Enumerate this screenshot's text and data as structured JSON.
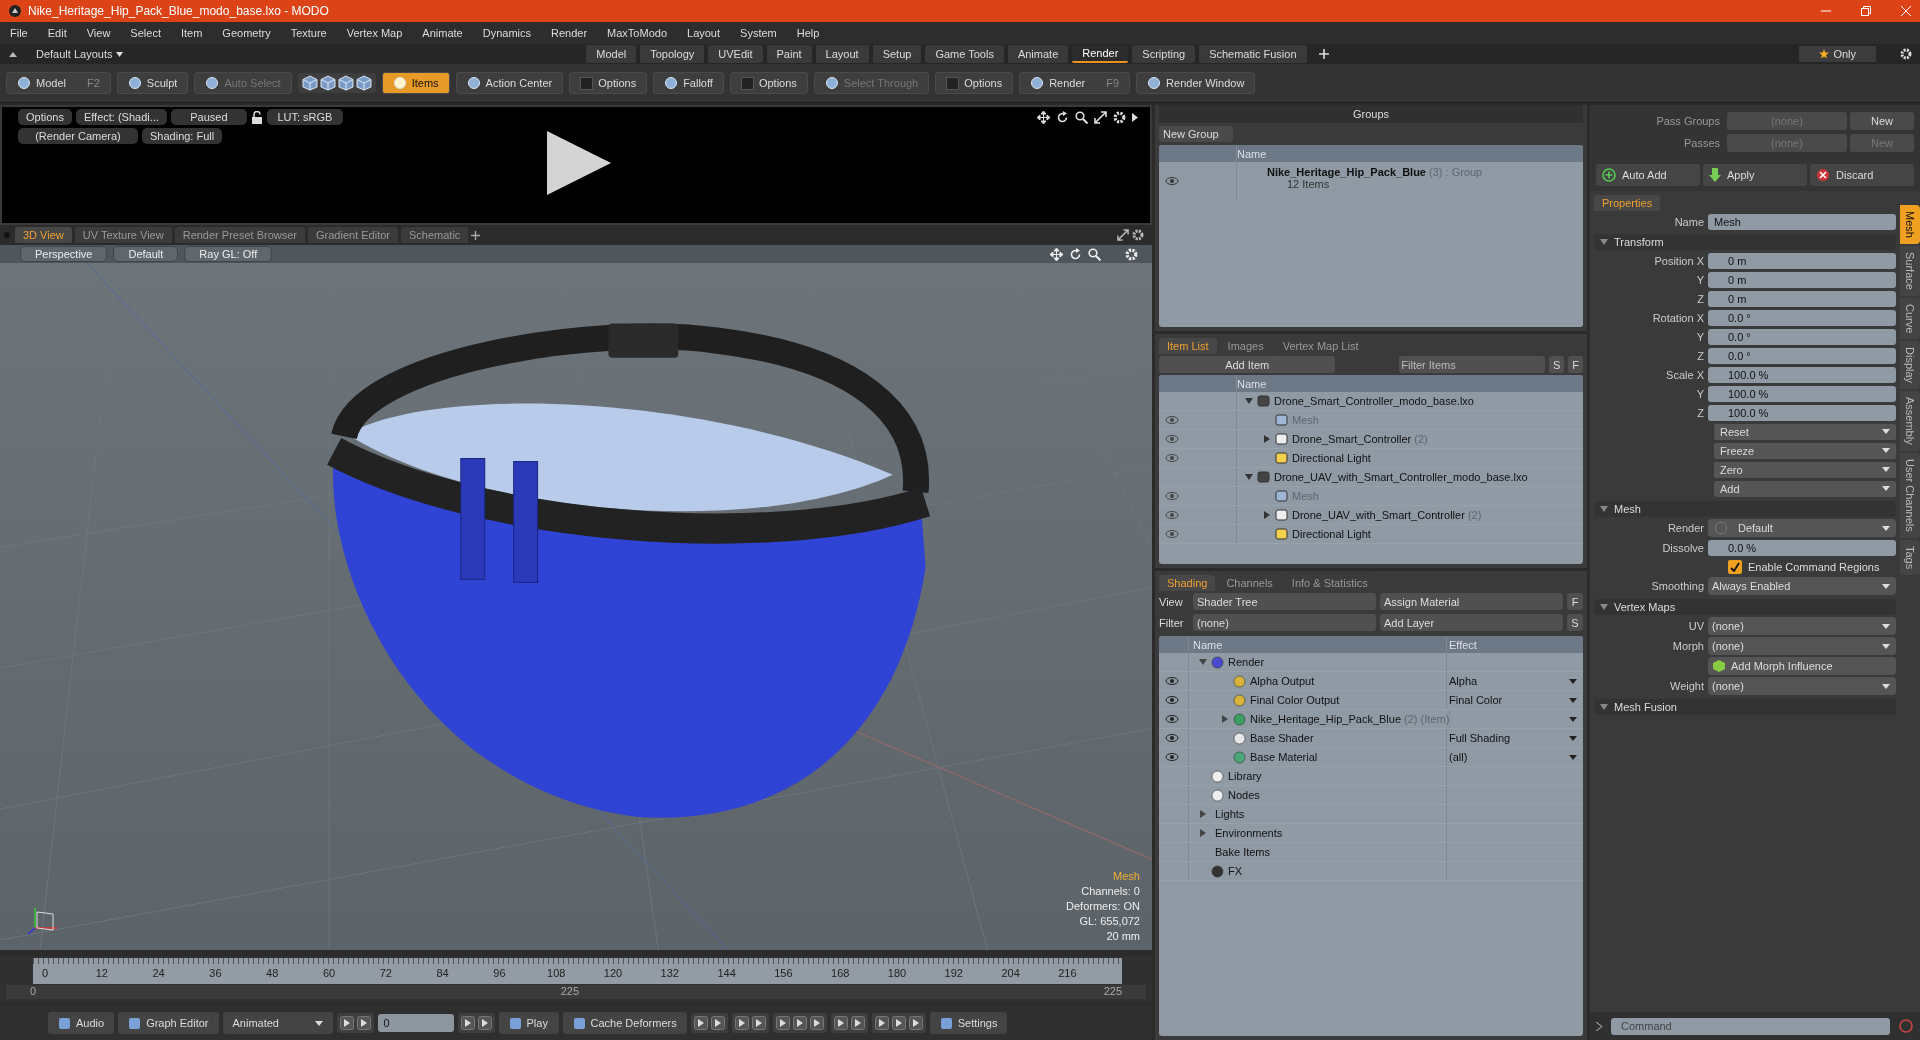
{
  "window": {
    "title": "Nike_Heritage_Hip_Pack_Blue_modo_base.lxo - MODO"
  },
  "menu": [
    "File",
    "Edit",
    "View",
    "Select",
    "Item",
    "Geometry",
    "Texture",
    "Vertex Map",
    "Animate",
    "Dynamics",
    "Render",
    "MaxToModo",
    "Layout",
    "System",
    "Help"
  ],
  "layouts": {
    "label": "Default Layouts",
    "only": "Only",
    "tabs": [
      {
        "label": "Model",
        "selected": false
      },
      {
        "label": "Topology",
        "selected": false
      },
      {
        "label": "UVEdit",
        "selected": false
      },
      {
        "label": "Paint",
        "selected": false
      },
      {
        "label": "Layout",
        "selected": false
      },
      {
        "label": "Setup",
        "selected": false
      },
      {
        "label": "Game Tools",
        "selected": false
      },
      {
        "label": "Animate",
        "selected": false
      },
      {
        "label": "Render",
        "selected": true
      },
      {
        "label": "Scripting",
        "selected": false
      },
      {
        "label": "Schematic Fusion",
        "selected": false
      }
    ]
  },
  "toolbar": [
    {
      "kind": "mode",
      "label": "Model",
      "shortcut": "F2",
      "selected": false,
      "disabled": false
    },
    {
      "kind": "mode",
      "label": "Sculpt",
      "selected": false,
      "disabled": false
    },
    {
      "kind": "mode",
      "label": "Auto Select",
      "selected": false,
      "disabled": true
    },
    {
      "kind": "cubes"
    },
    {
      "kind": "mode",
      "label": "Items",
      "selected": true,
      "disabled": false
    },
    {
      "kind": "mode",
      "label": "Action Center",
      "selected": false,
      "disabled": false
    },
    {
      "kind": "check",
      "label": "Options"
    },
    {
      "kind": "mode",
      "label": "Falloff",
      "selected": false,
      "disabled": false
    },
    {
      "kind": "check",
      "label": "Options"
    },
    {
      "kind": "mode",
      "label": "Select Through",
      "selected": false,
      "disabled": true
    },
    {
      "kind": "check",
      "label": "Options"
    },
    {
      "kind": "mode",
      "label": "Render",
      "shortcut": "F9",
      "selected": false,
      "disabled": false
    },
    {
      "kind": "mode",
      "label": "Render Window",
      "selected": false,
      "disabled": false
    }
  ],
  "preview": {
    "options": "Options",
    "effect": "Effect: (Shadi...",
    "state": "Paused",
    "lut": "LUT: sRGB",
    "camera": "(Render Camera)",
    "shading": "Shading: Full"
  },
  "viewport_tabs": [
    {
      "label": "3D View",
      "selected": true
    },
    {
      "label": "UV Texture View",
      "selected": false
    },
    {
      "label": "Render Preset Browser",
      "selected": false
    },
    {
      "label": "Gradient Editor",
      "selected": false
    },
    {
      "label": "Schematic",
      "selected": false
    }
  ],
  "viewport": {
    "buttons": [
      "Perspective",
      "Default",
      "Ray GL: Off"
    ],
    "info_title": "Mesh",
    "info": [
      "Channels: 0",
      "Deformers: ON",
      "GL: 655,072",
      "20 mm"
    ]
  },
  "timeline": {
    "ticks": [
      "0",
      "12",
      "24",
      "36",
      "48",
      "60",
      "72",
      "84",
      "96",
      "108",
      "120",
      "132",
      "144",
      "156",
      "168",
      "180",
      "192",
      "204",
      "216"
    ],
    "start": "0",
    "middle": "225",
    "end": "225"
  },
  "bottom_bar": [
    {
      "kind": "button",
      "label": "Audio"
    },
    {
      "kind": "button",
      "label": "Graph Editor"
    },
    {
      "kind": "dropdown",
      "label": "Animated"
    },
    {
      "kind": "icons2"
    },
    {
      "kind": "field",
      "label": "0"
    },
    {
      "kind": "icons2"
    },
    {
      "kind": "button",
      "label": "Play"
    },
    {
      "kind": "button",
      "label": "Cache Deformers"
    },
    {
      "kind": "icons2"
    },
    {
      "kind": "icons2"
    },
    {
      "kind": "icons3"
    },
    {
      "kind": "icons2"
    },
    {
      "kind": "icons3"
    },
    {
      "kind": "button",
      "label": "Settings"
    }
  ],
  "groups": {
    "title": "Groups",
    "new_group": "New Group",
    "column": "Name",
    "rows": [
      {
        "name": "Nike_Heritage_Hip_Pack_Blue",
        "count": "(3)",
        "type": ": Group",
        "items": "12 Items"
      }
    ]
  },
  "item_list": {
    "tabs": [
      {
        "label": "Item List",
        "selected": true
      },
      {
        "label": "Images",
        "selected": false
      },
      {
        "label": "Vertex Map List",
        "selected": false
      }
    ],
    "add_item": "Add Item",
    "filter_placeholder": "Filter Items",
    "s": "S",
    "f": "F",
    "column": "Name",
    "tree": [
      {
        "name": "Drone_Smart_Controller_modo_base.lxo",
        "kind": "scene",
        "expanded": true,
        "children": [
          {
            "name": "Mesh",
            "kind": "mesh",
            "visible": true
          },
          {
            "name": "Drone_Smart_Controller",
            "count": "(2)",
            "kind": "folder",
            "visible": true,
            "expanded": false
          },
          {
            "name": "Directional Light",
            "kind": "light",
            "visible": true
          }
        ]
      },
      {
        "name": "Drone_UAV_with_Smart_Controller_modo_base.lxo",
        "kind": "scene",
        "expanded": true,
        "children": [
          {
            "name": "Mesh",
            "kind": "mesh",
            "visible": true
          },
          {
            "name": "Drone_UAV_with_Smart_Controller",
            "count": "(2)",
            "kind": "folder",
            "visible": true,
            "expanded": false
          },
          {
            "name": "Directional Light",
            "kind": "light",
            "visible": true
          }
        ]
      }
    ]
  },
  "shading": {
    "tabs": [
      {
        "label": "Shading",
        "selected": true
      },
      {
        "label": "Channels",
        "selected": false
      },
      {
        "label": "Info & Statistics",
        "selected": false
      }
    ],
    "view_label": "View",
    "view": "Shader Tree",
    "assign": "Assign Material",
    "f": "F",
    "filter_label": "Filter",
    "filter": "(none)",
    "add_layer": "Add Layer",
    "s": "S",
    "columns": [
      "Name",
      "Effect"
    ],
    "tree": [
      {
        "name": "Render",
        "kind": "render",
        "expanded": true,
        "children": [
          {
            "name": "Alpha Output",
            "kind": "output",
            "visible": true,
            "effect": "Alpha"
          },
          {
            "name": "Final Color Output",
            "kind": "output",
            "visible": true,
            "effect": "Final Color"
          },
          {
            "name": "Nike_Heritage_Hip_Pack_Blue",
            "count": "(2)",
            "tag": "(Item)",
            "kind": "material-group",
            "visible": true,
            "expanded": false
          },
          {
            "name": "Base Shader",
            "kind": "shader",
            "visible": true,
            "effect": "Full Shading"
          },
          {
            "name": "Base Material",
            "kind": "material",
            "visible": true,
            "effect": "(all)"
          }
        ]
      },
      {
        "name": "Library",
        "kind": "folder"
      },
      {
        "name": "Nodes",
        "kind": "folder"
      },
      {
        "name": "Lights",
        "kind": "plain",
        "expanded": false
      },
      {
        "name": "Environments",
        "kind": "plain",
        "expanded": false
      },
      {
        "name": "Bake Items",
        "kind": "plain"
      },
      {
        "name": "FX",
        "kind": "fx"
      }
    ]
  },
  "passes": {
    "pass_groups_label": "Pass Groups",
    "pass_groups": "(none)",
    "pass_groups_button": "New",
    "passes_label": "Passes",
    "passes": "(none)",
    "passes_button": "New",
    "auto_add": "Auto Add",
    "apply": "Apply",
    "discard": "Discard"
  },
  "properties": {
    "tab": "Properties",
    "name_label": "Name",
    "name": "Mesh",
    "side_tabs": [
      {
        "label": "Mesh",
        "selected": true
      },
      {
        "label": "Surface",
        "selected": false
      },
      {
        "label": "Curve",
        "selected": false
      },
      {
        "label": "Display",
        "selected": false
      },
      {
        "label": "Assembly",
        "selected": false
      },
      {
        "label": "User Channels",
        "selected": false
      },
      {
        "label": "Tags",
        "selected": false
      }
    ],
    "sections": [
      {
        "title": "Transform",
        "expanded": true,
        "rows": [
          {
            "kind": "number",
            "label": "Position X",
            "value": "0 m"
          },
          {
            "kind": "number",
            "label": "Y",
            "value": "0 m"
          },
          {
            "kind": "number",
            "label": "Z",
            "value": "0 m"
          },
          {
            "kind": "number",
            "label": "Rotation X",
            "value": "0.0 °"
          },
          {
            "kind": "number",
            "label": "Y",
            "value": "0.0 °"
          },
          {
            "kind": "number",
            "label": "Z",
            "value": "0.0 °"
          },
          {
            "kind": "number",
            "label": "Scale X",
            "value": "100.0 %"
          },
          {
            "kind": "number",
            "label": "Y",
            "value": "100.0 %"
          },
          {
            "kind": "number",
            "label": "Z",
            "value": "100.0 %"
          },
          {
            "kind": "menu",
            "value": "Reset"
          },
          {
            "kind": "menu",
            "value": "Freeze"
          },
          {
            "kind": "menu",
            "value": "Zero"
          },
          {
            "kind": "menu",
            "value": "Add"
          }
        ]
      },
      {
        "title": "Mesh",
        "expanded": true,
        "rows": [
          {
            "kind": "channel-select",
            "label": "Render",
            "value": "Default"
          },
          {
            "kind": "number",
            "label": "Dissolve",
            "value": "0.0 %"
          },
          {
            "kind": "checkbox",
            "value": "Enable Command Regions",
            "checked": true
          },
          {
            "kind": "select",
            "label": "Smoothing",
            "value": "Always Enabled"
          }
        ]
      },
      {
        "title": "Vertex Maps",
        "expanded": true,
        "rows": [
          {
            "kind": "select",
            "label": "UV",
            "value": "(none)"
          },
          {
            "kind": "select",
            "label": "Morph",
            "value": "(none)"
          },
          {
            "kind": "button",
            "value": "Add Morph Influence"
          },
          {
            "kind": "select",
            "label": "Weight",
            "value": "(none)"
          }
        ]
      },
      {
        "title": "Mesh Fusion",
        "expanded": true
      }
    ]
  },
  "command": {
    "placeholder": "Command"
  }
}
